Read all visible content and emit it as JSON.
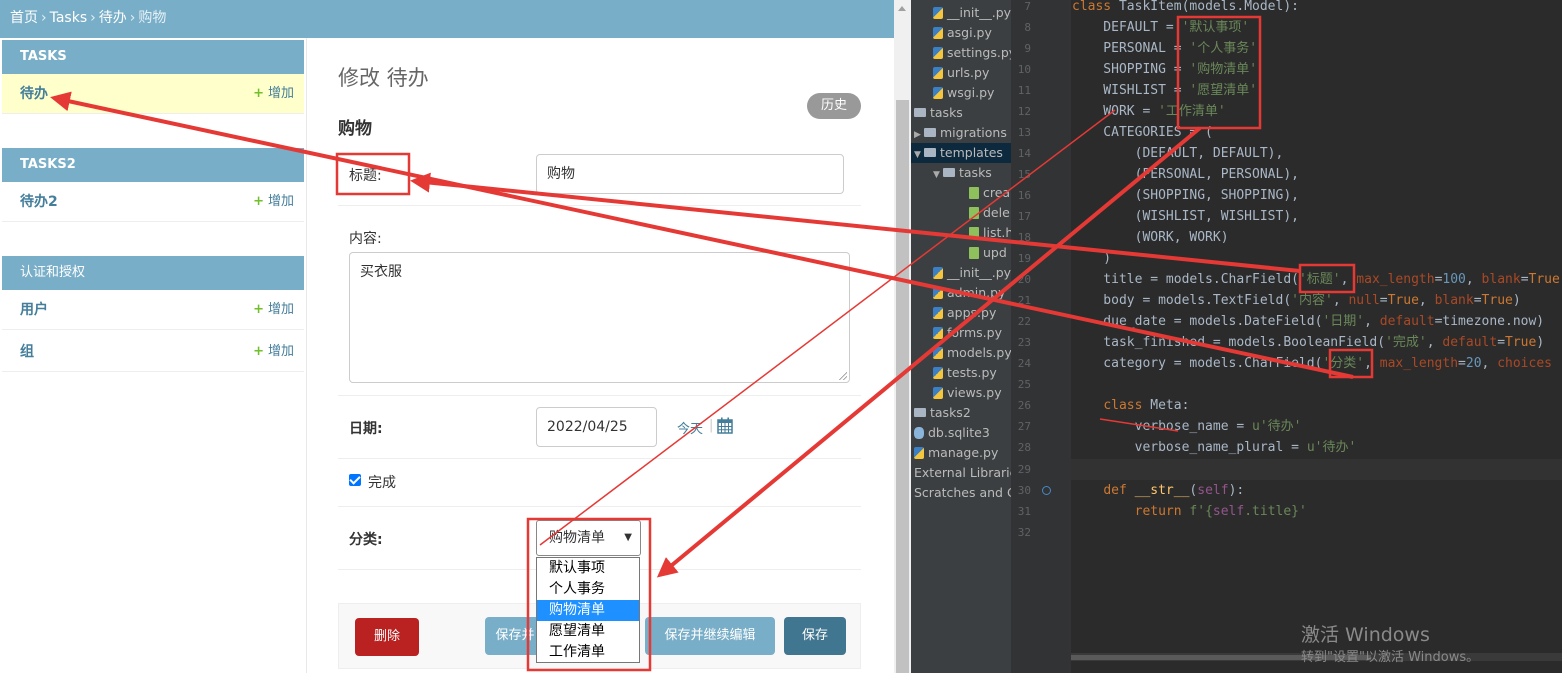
{
  "admin": {
    "breadcrumbs": [
      "首页",
      "Tasks",
      "待办",
      "购物"
    ],
    "breadcrumb_sep": "›",
    "nav": {
      "modules": [
        {
          "caption": "TASKS",
          "items": [
            {
              "label": "待办",
              "add": "增加"
            }
          ]
        },
        {
          "caption": "TASKS2",
          "items": [
            {
              "label": "待办2",
              "add": "增加"
            }
          ]
        },
        {
          "caption": "认证和授权",
          "items": [
            {
              "label": "用户",
              "add": "增加"
            },
            {
              "label": "组",
              "add": "增加"
            }
          ]
        }
      ],
      "plus": "+"
    },
    "page_title": "修改 待办",
    "history_label": "历史",
    "object_title": "购物",
    "form": {
      "title_label": "标题:",
      "title_value": "购物",
      "body_label": "内容:",
      "body_value": "买衣服",
      "date_label": "日期:",
      "date_value": "2022/04/25",
      "today_label": "今天",
      "today_sep": "|",
      "finished_label": "完成",
      "finished_checked": true,
      "category_label": "分类:",
      "category_selected": "购物清单",
      "category_options": [
        "默认事项",
        "个人事务",
        "购物清单",
        "愿望清单",
        "工作清单"
      ],
      "category_highlighted_index": 2
    },
    "buttons": {
      "delete": "删除",
      "save_add": "保存并",
      "save_continue": "保存并继续编辑",
      "save": "保存"
    },
    "colors": {
      "header": "#79aec8",
      "link": "#447e9b",
      "delete": "#ba2121",
      "save": "#417690",
      "annotation": "#e53935"
    }
  },
  "ide": {
    "tree": [
      {
        "label": "__init__.py",
        "icon": "python-file-icon"
      },
      {
        "label": "asgi.py",
        "icon": "python-file-icon"
      },
      {
        "label": "settings.py",
        "icon": "python-file-icon"
      },
      {
        "label": "urls.py",
        "icon": "python-file-icon"
      },
      {
        "label": "wsgi.py",
        "icon": "python-file-icon"
      },
      {
        "label": "tasks",
        "icon": "folder-icon"
      },
      {
        "label": "migrations",
        "icon": "folder-icon"
      },
      {
        "label": "templates",
        "icon": "folder-icon"
      },
      {
        "label": "tasks",
        "icon": "folder-icon"
      },
      {
        "label": "crea",
        "icon": "html-file-icon"
      },
      {
        "label": "dele",
        "icon": "html-file-icon"
      },
      {
        "label": "list.h",
        "icon": "html-file-icon"
      },
      {
        "label": "upd",
        "icon": "html-file-icon"
      },
      {
        "label": "__init__.py",
        "icon": "python-file-icon"
      },
      {
        "label": "admin.py",
        "icon": "python-file-icon"
      },
      {
        "label": "apps.py",
        "icon": "python-file-icon"
      },
      {
        "label": "forms.py",
        "icon": "python-file-icon"
      },
      {
        "label": "models.py",
        "icon": "python-file-icon"
      },
      {
        "label": "tests.py",
        "icon": "python-file-icon"
      },
      {
        "label": "views.py",
        "icon": "python-file-icon"
      },
      {
        "label": "tasks2",
        "icon": "folder-icon"
      },
      {
        "label": "db.sqlite3",
        "icon": "database-icon"
      },
      {
        "label": "manage.py",
        "icon": "python-file-icon"
      },
      {
        "label": "External Libraries",
        "icon": ""
      },
      {
        "label": "Scratches and Co",
        "icon": ""
      }
    ],
    "line_numbers": [
      "7",
      "8",
      "9",
      "10",
      "11",
      "12",
      "13",
      "14",
      "15",
      "16",
      "17",
      "18",
      "19",
      "20",
      "21",
      "22",
      "23",
      "24",
      "25",
      "26",
      "27",
      "28",
      "29",
      "30",
      "31",
      "32"
    ],
    "code": {
      "l7": [
        "class ",
        "TaskItem",
        "(models.Model):"
      ],
      "l8": [
        "    DEFAULT = ",
        "'默认事项'"
      ],
      "l9": [
        "    PERSONAL = ",
        "'个人事务'"
      ],
      "l10": [
        "    SHOPPING = ",
        "'购物清单'"
      ],
      "l11": [
        "    WISHLIST = ",
        "'愿望清单'"
      ],
      "l12": [
        "    WORK = ",
        "'工作清单'"
      ],
      "l13": "    CATEGORIES = (",
      "l14": "        (DEFAULT, DEFAULT),",
      "l15": "        (PERSONAL, PERSONAL),",
      "l16": "        (SHOPPING, SHOPPING),",
      "l17": "        (WISHLIST, WISHLIST),",
      "l18": "        (WORK, WORK)",
      "l19": "    )",
      "l20": [
        "    title = models.CharField(",
        "'标题'",
        ", ",
        "max_length",
        "=",
        "100",
        ", ",
        "blank",
        "=",
        "True"
      ],
      "l21": [
        "    body = models.TextField(",
        "'内容'",
        ", ",
        "null",
        "=",
        "True",
        ", ",
        "blank",
        "=",
        "True",
        ")"
      ],
      "l22": [
        "    due_date = models.DateField(",
        "'日期'",
        ", ",
        "default",
        "=timezone.now)"
      ],
      "l23": [
        "    task_finished = models.BooleanField(",
        "'完成'",
        ", ",
        "default",
        "=",
        "True",
        ")"
      ],
      "l24": [
        "    category = models.CharField(",
        "'分类'",
        ", ",
        "max_length",
        "=",
        "20",
        ", ",
        "choices"
      ],
      "l26": [
        "    ",
        "class ",
        "Meta:"
      ],
      "l27": [
        "        verbose_name = ",
        "u'待办'"
      ],
      "l28": [
        "        verbose_name_plural = ",
        "u'待办'"
      ],
      "l30": [
        "    ",
        "def ",
        "__str__",
        "(",
        "self",
        "):"
      ],
      "l31": [
        "        ",
        "return ",
        "f'{",
        "self",
        ".title}'"
      ]
    },
    "watermark": {
      "line1": "激活 Windows",
      "line2": "转到\"设置\"以激活 Windows。"
    }
  }
}
